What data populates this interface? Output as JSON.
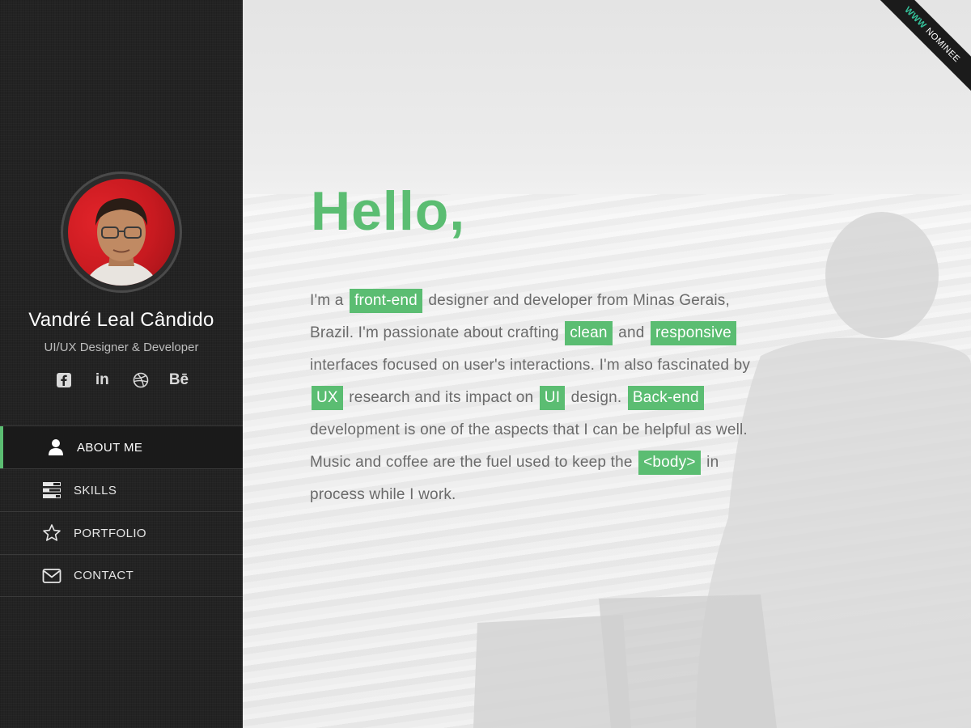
{
  "profile": {
    "name": "Vandré Leal Cândido",
    "role": "UI/UX Designer & Developer",
    "socials": [
      {
        "icon": "facebook-icon"
      },
      {
        "icon": "linkedin-icon",
        "label": "in"
      },
      {
        "icon": "dribbble-icon"
      },
      {
        "icon": "behance-icon",
        "label": "Bē"
      }
    ]
  },
  "nav": {
    "items": [
      {
        "label": "ABOUT ME",
        "icon": "user-icon",
        "active": true
      },
      {
        "label": "SKILLS",
        "icon": "skills-icon",
        "active": false
      },
      {
        "label": "PORTFOLIO",
        "icon": "star-icon",
        "active": false
      },
      {
        "label": "CONTACT",
        "icon": "mail-icon",
        "active": false
      }
    ]
  },
  "ribbon": {
    "www": "WWW",
    "text": "NOMINEE"
  },
  "main": {
    "heading": "Hello,",
    "bio": {
      "t1": "I'm a ",
      "h1": "front-end",
      "t2": " designer and developer from Minas Gerais, Brazil. I'm passionate about crafting ",
      "h2": "clean",
      "t3": " and ",
      "h3": "responsive",
      "t4": " interfaces focused on user's interactions. I'm also fascinated by ",
      "h4": "UX",
      "t5": " research and its impact on ",
      "h5": "UI",
      "t6": " design. ",
      "h6": "Back-end",
      "t7": " development is one of the aspects that I can be helpful as well. Music and coffee are the fuel used to keep the ",
      "h7": "<body>",
      "t8": " in process while I work."
    }
  },
  "colors": {
    "accent": "#5bbd72",
    "sidebar_bg": "#232323",
    "text_muted": "#6a6a6a"
  }
}
